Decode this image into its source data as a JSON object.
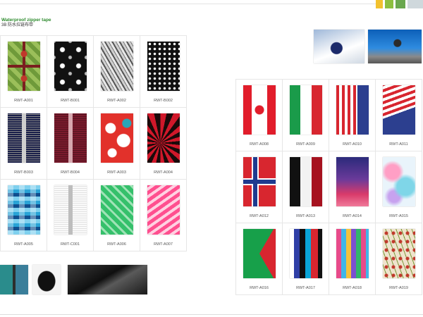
{
  "page": {
    "title_en": "Waterproof zipper tape",
    "title_cn": "3B 防水拉链布带"
  },
  "left_grid": [
    {
      "code": "RWT-A001",
      "pattern": "kaleido-green"
    },
    {
      "code": "RWT-B001",
      "pattern": "snowflake-black"
    },
    {
      "code": "RWT-A002",
      "pattern": "zebra-grey"
    },
    {
      "code": "RWT-B002",
      "pattern": "dots-black"
    },
    {
      "code": "RWT-B003",
      "pattern": "zipper-navy"
    },
    {
      "code": "RWT-B004",
      "pattern": "zipper-maroon"
    },
    {
      "code": "RWT-A003",
      "pattern": "hibiscus"
    },
    {
      "code": "RWT-A004",
      "pattern": "rays-red"
    },
    {
      "code": "RWT-A005",
      "pattern": "squares-blue"
    },
    {
      "code": "RWT-C001",
      "pattern": "white-zipper"
    },
    {
      "code": "RWT-A006",
      "pattern": "chevron-green"
    },
    {
      "code": "RWT-A007",
      "pattern": "waves-pink"
    }
  ],
  "right_grid": [
    {
      "code": "RWT-A008",
      "pattern": "flag-canada"
    },
    {
      "code": "RWT-A009",
      "pattern": "flag-italy"
    },
    {
      "code": "RWT-A010",
      "pattern": "stripes-usa"
    },
    {
      "code": "RWT-A011",
      "pattern": "flag-usa-diag"
    },
    {
      "code": "RWT-A012",
      "pattern": "flag-norway"
    },
    {
      "code": "RWT-A013",
      "pattern": "tricolor-dark"
    },
    {
      "code": "RWT-A014",
      "pattern": "gradient-purple"
    },
    {
      "code": "RWT-A015",
      "pattern": "watercolor"
    },
    {
      "code": "RWT-A016",
      "pattern": "green-red-triangles"
    },
    {
      "code": "RWT-A017",
      "pattern": "stripes-multi"
    },
    {
      "code": "RWT-A018",
      "pattern": "letters-colorful"
    },
    {
      "code": "RWT-A019",
      "pattern": "floral-vine"
    }
  ],
  "colors": {
    "title_green": "#2e8b2e",
    "grid_border": "#e6e6e6",
    "label_text": "#555555"
  }
}
